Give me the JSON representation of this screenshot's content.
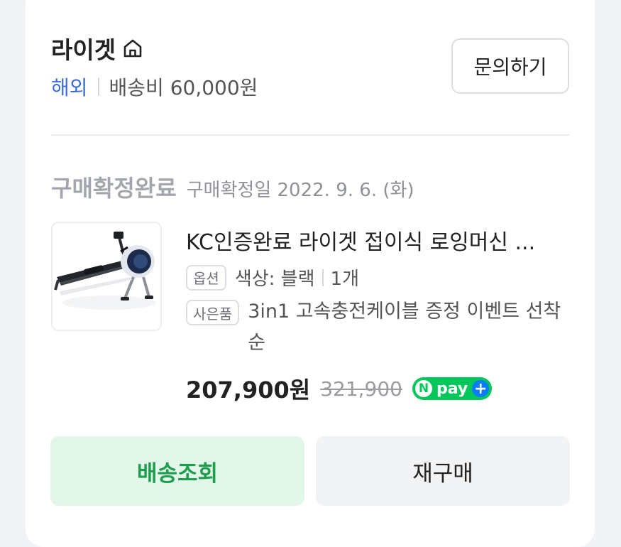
{
  "seller": {
    "name": "라이겟",
    "region": "해외",
    "shipping": "배송비 60,000원",
    "inquiry_label": "문의하기"
  },
  "order": {
    "status": "구매확정완료",
    "date": "구매확정일 2022. 9. 6. (화)"
  },
  "product": {
    "title": "KC인증완료 라이겟 접이식 로잉머신 ...",
    "option_tag": "옵션",
    "option_value": "색상: 블랙",
    "quantity": "1개",
    "gift_tag": "사은품",
    "gift_value": "3in1 고속충전케이블 증정 이벤트 선착순",
    "price": "207,900원",
    "original_price": "321,900",
    "npay_n": "N",
    "npay_label": "pay",
    "npay_plus": "+"
  },
  "actions": {
    "track_label": "배송조회",
    "rebuy_label": "재구매"
  },
  "colors": {
    "accent_blue": "#3b6bd6",
    "npay_green": "#03c75a",
    "track_green": "#1e9d4d"
  }
}
